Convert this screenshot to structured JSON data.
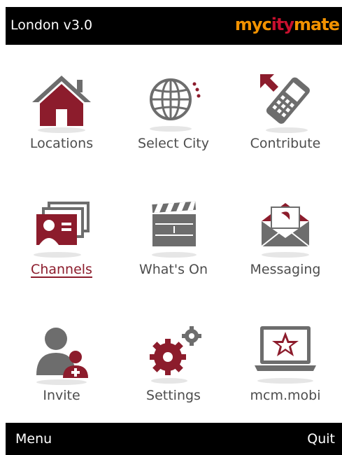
{
  "header": {
    "title": "London v3.0",
    "logo_text": "mycitymate"
  },
  "colors": {
    "accent": "#8c1c2c",
    "grey": "#6d6d6d",
    "logo_orange": "#f29200",
    "bar": "#000000"
  },
  "menu": {
    "items": [
      {
        "label": "Locations",
        "icon": "home-icon"
      },
      {
        "label": "Select City",
        "icon": "globe-icon"
      },
      {
        "label": "Contribute",
        "icon": "phone-upload-icon"
      },
      {
        "label": "Channels",
        "icon": "channels-icon",
        "selected": true
      },
      {
        "label": "What's On",
        "icon": "clapperboard-icon"
      },
      {
        "label": "Messaging",
        "icon": "envelope-icon"
      },
      {
        "label": "Invite",
        "icon": "add-user-icon"
      },
      {
        "label": "Settings",
        "icon": "gears-icon"
      },
      {
        "label": "mcm.mobi",
        "icon": "laptop-star-icon"
      }
    ]
  },
  "softkeys": {
    "left": "Menu",
    "right": "Quit"
  }
}
